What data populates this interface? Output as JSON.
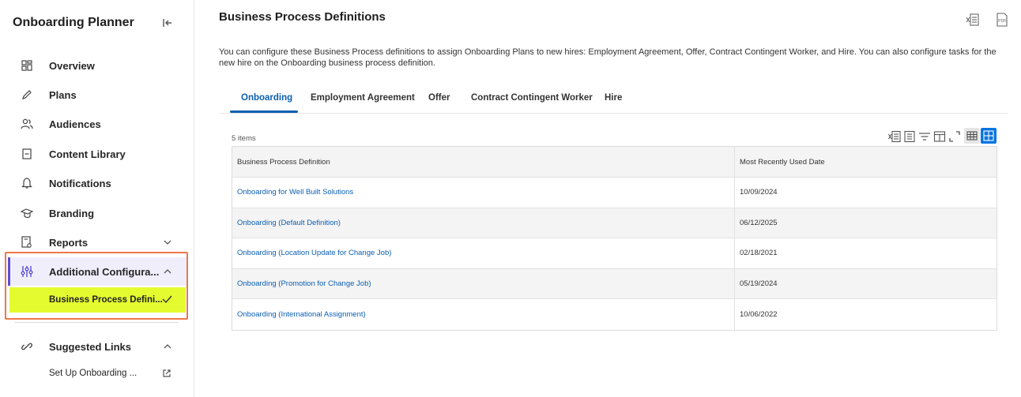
{
  "sidebar": {
    "title": "Onboarding Planner",
    "items": [
      {
        "label": "Overview",
        "icon": "dashboard-icon"
      },
      {
        "label": "Plans",
        "icon": "pencil-icon"
      },
      {
        "label": "Audiences",
        "icon": "people-icon"
      },
      {
        "label": "Content Library",
        "icon": "document-icon"
      },
      {
        "label": "Notifications",
        "icon": "bell-icon"
      },
      {
        "label": "Branding",
        "icon": "branding-icon"
      },
      {
        "label": "Reports",
        "icon": "report-icon"
      },
      {
        "label": "Additional Configura...",
        "icon": "sliders-icon"
      }
    ],
    "sub_item": "Business Process Defini...",
    "suggested_links_title": "Suggested Links",
    "suggested_link": "Set Up Onboarding ..."
  },
  "main": {
    "title": "Business Process Definitions",
    "description": "You can configure these Business Process definitions to assign Onboarding Plans to new hires: Employment Agreement, Offer, Contract  Contingent Worker, and Hire. You can also configure tasks for the new hire on the Onboarding business process definition.",
    "tabs": [
      "Onboarding",
      "Employment Agreement",
      "Offer",
      "Contract Contingent Worker",
      "Hire"
    ],
    "item_count": "5 items",
    "table": {
      "headers": [
        "Business Process Definition",
        "Most Recently Used Date"
      ],
      "rows": [
        {
          "name": "Onboarding for Well Built Solutions",
          "date": "10/09/2024"
        },
        {
          "name": "Onboarding (Default Definition)",
          "date": "06/12/2025"
        },
        {
          "name": "Onboarding (Location Update for Change Job)",
          "date": "02/18/2021"
        },
        {
          "name": "Onboarding (Promotion for Change Job)",
          "date": "05/19/2024"
        },
        {
          "name": "Onboarding (International Assignment)",
          "date": "10/06/2022"
        }
      ]
    }
  },
  "colors": {
    "accent": "#0b5fb3",
    "highlight": "#e4fb30",
    "outline": "#f0774a",
    "active_bar": "#5b4fd3"
  }
}
